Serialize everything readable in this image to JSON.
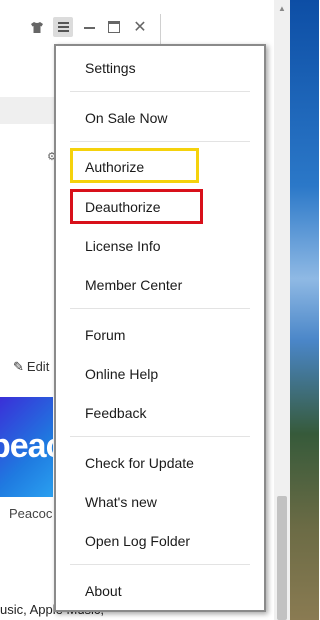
{
  "titlebar": {
    "skin_icon": "tshirt-icon",
    "menu_icon": "hamburger-menu-icon",
    "minimize_icon": "minimize-icon",
    "maximize_icon": "maximize-icon",
    "close_icon": "close-icon"
  },
  "background": {
    "edit_label": "Edit",
    "tile_text": "peacoc",
    "tile_name": "Peacoc",
    "bottom_text": "usic, Apple Music,"
  },
  "menu": {
    "groups": [
      {
        "items": [
          "Settings"
        ]
      },
      {
        "items": [
          "On Sale Now"
        ]
      },
      {
        "items": [
          "Authorize",
          "Deauthorize",
          "License Info",
          "Member Center"
        ]
      },
      {
        "items": [
          "Forum",
          "Online Help",
          "Feedback"
        ]
      },
      {
        "items": [
          "Check for Update",
          "What's new",
          "Open Log Folder"
        ]
      },
      {
        "items": [
          "About"
        ]
      }
    ]
  },
  "highlights": {
    "authorize_color": "#f5d20c",
    "deauthorize_color": "#d8101a"
  }
}
